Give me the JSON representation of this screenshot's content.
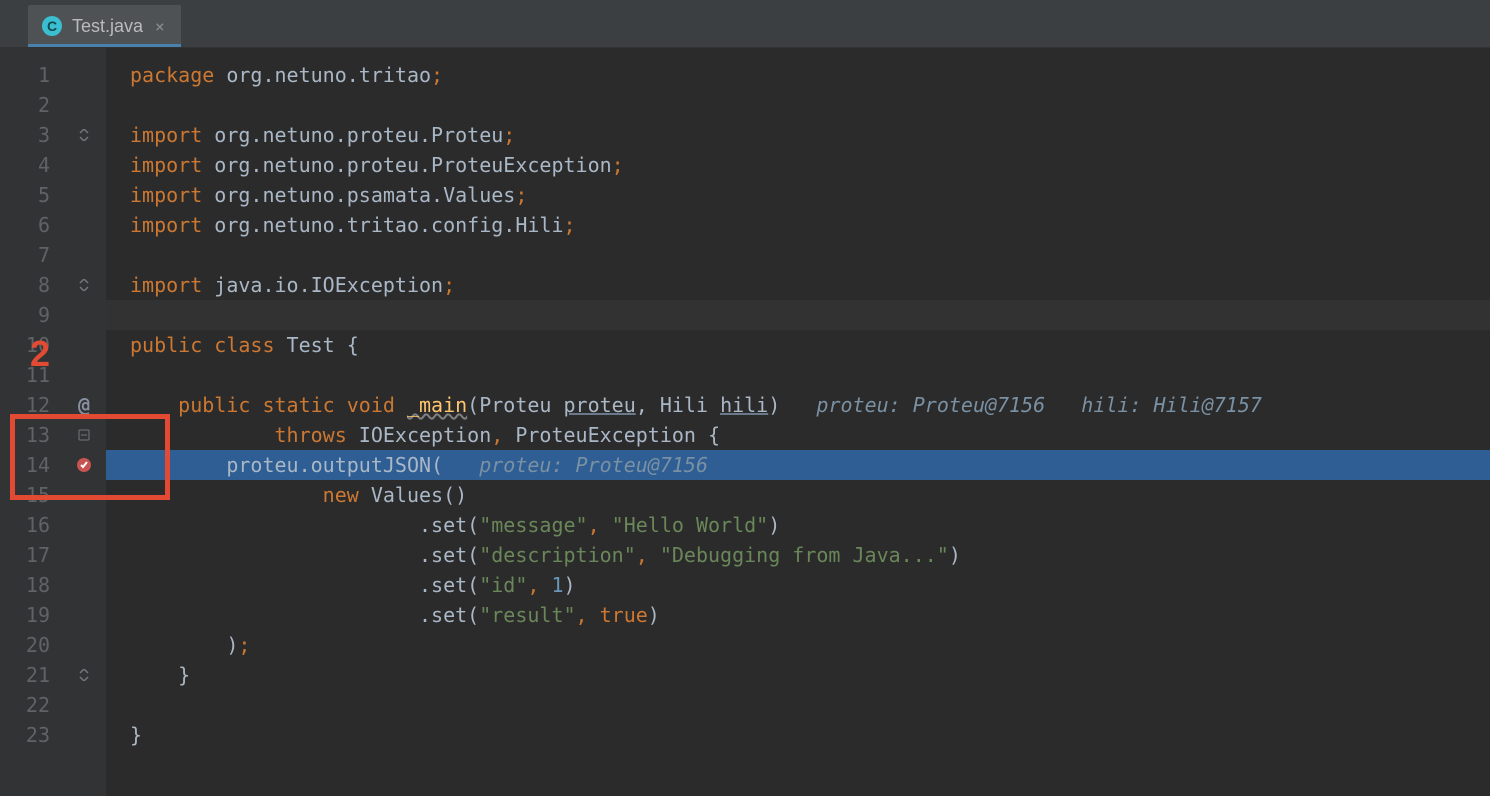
{
  "tab": {
    "icon_letter": "C",
    "filename": "Test.java",
    "close": "×"
  },
  "annotation": {
    "label": "2"
  },
  "gutter": {
    "line_numbers": [
      "1",
      "2",
      "3",
      "4",
      "5",
      "6",
      "7",
      "8",
      "9",
      "10",
      "11",
      "12",
      "13",
      "14",
      "15",
      "16",
      "17",
      "18",
      "19",
      "20",
      "21",
      "22",
      "23"
    ]
  },
  "code": {
    "l1": {
      "kw": "package ",
      "rest": "org.netuno.tritao",
      "semi": ";"
    },
    "l3": {
      "kw": "import ",
      "rest": "org.netuno.proteu.Proteu",
      "semi": ";"
    },
    "l4": {
      "kw": "import ",
      "rest": "org.netuno.proteu.ProteuException",
      "semi": ";"
    },
    "l5": {
      "kw": "import ",
      "rest": "org.netuno.psamata.Values",
      "semi": ";"
    },
    "l6": {
      "kw": "import ",
      "rest": "org.netuno.tritao.config.Hili",
      "semi": ";"
    },
    "l8": {
      "kw": "import ",
      "rest": "java.io.IOException",
      "semi": ";"
    },
    "l10": {
      "kw1": "public class ",
      "cls": "Test ",
      "brace": "{"
    },
    "l12": {
      "ind": "    ",
      "kw1": "public static void ",
      "fn": "_main",
      "sig1": "(Proteu ",
      "p1u": "proteu",
      "sig2": ", ",
      "p2": "Hili ",
      "p2u": "hili",
      "sig3": ")",
      "hint": "   proteu: Proteu@7156   hili: Hili@7157"
    },
    "l13": {
      "ind": "            ",
      "kw": "throws ",
      "rest": "IOException",
      "c": ", ",
      "rest2": "ProteuException ",
      "brace": "{"
    },
    "l14": {
      "ind": "        ",
      "obj": "proteu",
      "dot": ".",
      "m": "outputJSON",
      "paren": "(",
      "hint": "   proteu: Proteu@7156"
    },
    "l15": {
      "ind": "                ",
      "kw": "new ",
      "cls": "Values()"
    },
    "l16": {
      "ind": "                        .",
      "m": "set(",
      "s1": "\"message\"",
      "c": ", ",
      "s2": "\"Hello World\"",
      "end": ")"
    },
    "l17": {
      "ind": "                        .",
      "m": "set(",
      "s1": "\"description\"",
      "c": ", ",
      "s2": "\"Debugging from Java...\"",
      "end": ")"
    },
    "l18": {
      "ind": "                        .",
      "m": "set(",
      "s1": "\"id\"",
      "c": ", ",
      "n": "1",
      "end": ")"
    },
    "l19": {
      "ind": "                        .",
      "m": "set(",
      "s1": "\"result\"",
      "c": ", ",
      "b": "true",
      "end": ")"
    },
    "l20": {
      "ind": "        )",
      "semi": ";"
    },
    "l21": {
      "ind": "    }"
    },
    "l23": {
      "ind": "}"
    }
  }
}
